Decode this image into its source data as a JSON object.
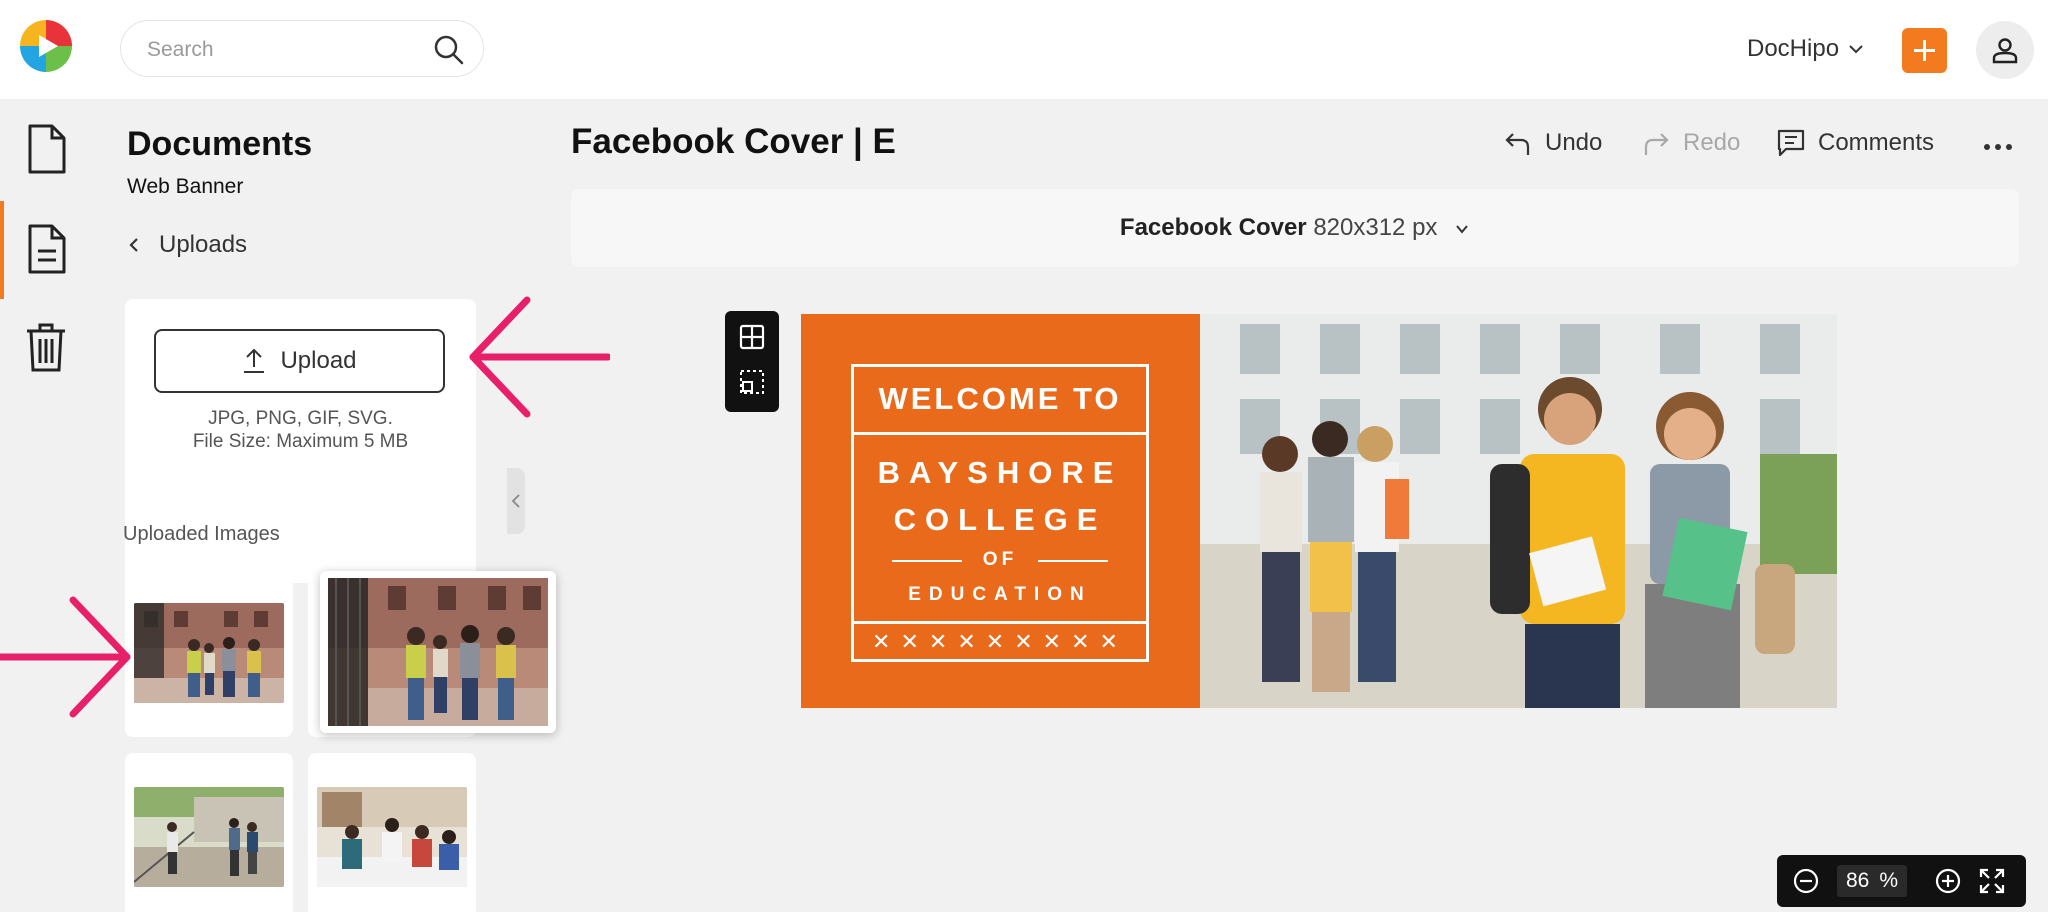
{
  "search": {
    "placeholder": "Search"
  },
  "header": {
    "brand_menu_label": "DocHipo"
  },
  "panel": {
    "title": "Documents",
    "subtitle": "Web Banner",
    "back_label": "Uploads",
    "upload_button_label": "Upload",
    "upload_formats": "JPG, PNG, GIF, SVG.",
    "upload_size": "File Size: Maximum 5 MB",
    "uploaded_images_title": "Uploaded Images"
  },
  "document": {
    "title": "Facebook Cover | E"
  },
  "toolbar": {
    "undo_label": "Undo",
    "redo_label": "Redo",
    "comments_label": "Comments"
  },
  "size_bar": {
    "name": "Facebook Cover",
    "dimensions": "820x312 px"
  },
  "banner": {
    "welcome": "WELCOME TO",
    "line1": "BAYSHORE",
    "line2": "COLLEGE",
    "of": "OF",
    "education": "EDUCATION",
    "decor": "✕✕✕✕✕✕✕✕✕"
  },
  "zoom": {
    "value": "86",
    "unit": "%"
  },
  "colors": {
    "accent": "#f47a1f",
    "banner_bg": "#ea6a1c",
    "arrow": "#e8206a"
  }
}
